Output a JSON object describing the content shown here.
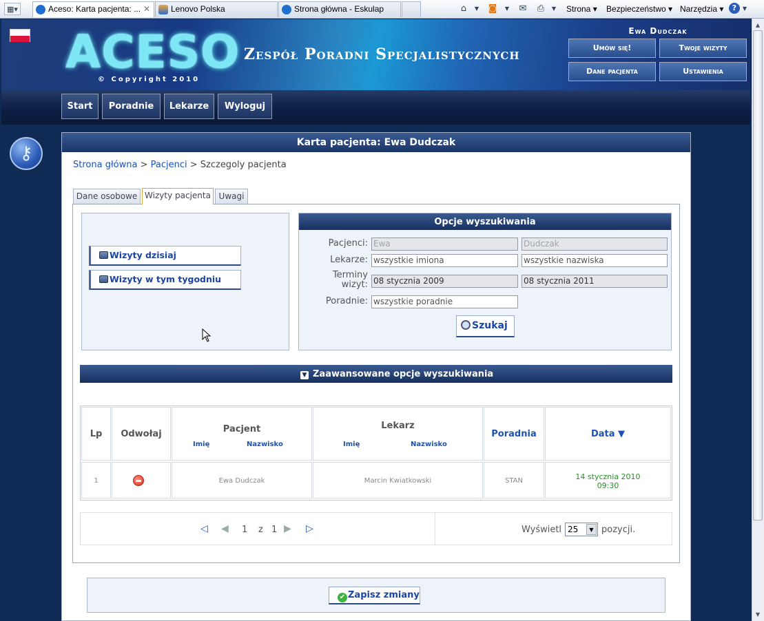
{
  "browser": {
    "tabs": [
      {
        "label": "Aceso: Karta pacjenta: ...",
        "active": true
      },
      {
        "label": "Lenovo Polska",
        "active": false
      },
      {
        "label": "Strona główna - Eskulap",
        "active": false
      }
    ],
    "close_glyph": "✕",
    "menus": {
      "page": "Strona",
      "security": "Bezpieczeństwo",
      "tools": "Narzędzia"
    }
  },
  "header": {
    "logo": "ACESO",
    "copyright": "© Copyright 2010",
    "clinic_name": "Zespół Poradni Specjalistycznych",
    "user_name": "Ewa Dudczak",
    "buttons": {
      "book": "Umów się!",
      "my_visits": "Twoje wizyty",
      "patient_data": "Dane pacjenta",
      "settings": "Ustawienia"
    }
  },
  "nav": {
    "start": "Start",
    "clinics": "Poradnie",
    "doctors": "Lekarze",
    "logout": "Wyloguj"
  },
  "panel": {
    "title": "Karta pacjenta: Ewa Dudczak",
    "breadcrumb": {
      "home": "Strona główna",
      "sep1": " > ",
      "patients": "Pacjenci",
      "sep2": " > ",
      "current": "Szczegoly pacjenta"
    },
    "tabs": {
      "personal": "Dane osobowe",
      "visits": "Wizyty pacjenta",
      "notes": "Uwagi"
    }
  },
  "quick": {
    "today": "Wizyty dzisiaj",
    "this_week": "Wizyty w tym tygodniu"
  },
  "search": {
    "title": "Opcje wyszukiwania",
    "labels": {
      "patients": "Pacjenci:",
      "doctors": "Lekarze:",
      "dates_1": "Terminy",
      "dates_2": "wizyt:",
      "clinics": "Poradnie:"
    },
    "patient_first": "Ewa",
    "patient_last": "Dudczak",
    "doctor_first": "wszystkie imiona",
    "doctor_last": "wszystkie nazwiska",
    "date_from": "08 stycznia 2009",
    "date_to": "08 stycznia 2011",
    "clinic": "wszystkie poradnie",
    "button": "Szukaj"
  },
  "advanced": {
    "label": "Zaawansowane opcje wyszukiwania",
    "icon": "chevron-down-icon"
  },
  "table": {
    "headers": {
      "lp": "Lp",
      "cancel": "Odwołaj",
      "patient": "Pacjent",
      "doctor": "Lekarz",
      "clinic": "Poradnia",
      "date": "Data ▼"
    },
    "sub": {
      "first": "Imię",
      "last": "Nazwisko"
    },
    "rows": [
      {
        "lp": "1",
        "patient": "Ewa Dudczak",
        "doctor": "Marcin Kwiatkowski",
        "clinic": "STAN",
        "date": "14 stycznia 2010",
        "time": "09:30"
      }
    ],
    "date_color": "#2a8a2a"
  },
  "pager": {
    "page": "1",
    "of": "z",
    "total": "1",
    "show": "Wyświetl",
    "per_page": "25",
    "items": "pozycji."
  },
  "save": "Zapisz zmiany",
  "colors": {
    "header_dark": "#1a3568",
    "link": "#1a52b8",
    "page_bg": "#0f2a55"
  }
}
